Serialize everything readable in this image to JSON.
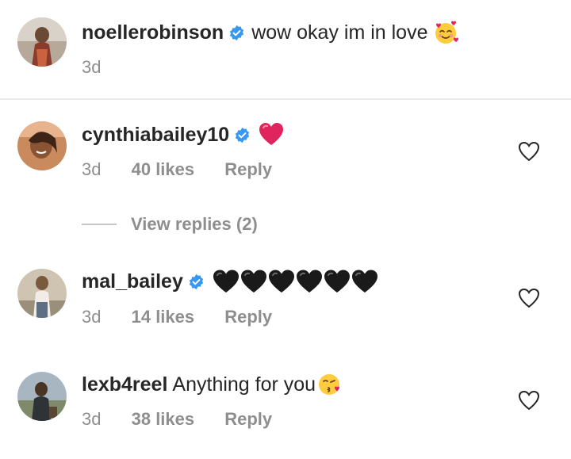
{
  "caption": {
    "username": "noellerobinson",
    "text": "wow okay im in love",
    "emoji": "smiling-face-with-hearts",
    "time": "3d"
  },
  "comments": [
    {
      "username": "cynthiabailey10",
      "verified": true,
      "text": "",
      "emoji": "red-heart",
      "time": "3d",
      "likes": "40 likes",
      "reply": "Reply"
    },
    {
      "username": "mal_bailey",
      "verified": true,
      "text": "",
      "emoji": "black-heart x6",
      "time": "3d",
      "likes": "14 likes",
      "reply": "Reply"
    },
    {
      "username": "lexb4reel",
      "verified": false,
      "text": "Anything for you",
      "emoji": "face-blowing-a-kiss",
      "time": "3d",
      "likes": "38 likes",
      "reply": "Reply"
    }
  ],
  "view_replies": "View replies (2)",
  "colors": {
    "verified_blue": "#3897f0",
    "muted_text": "#8e8e8e",
    "primary_text": "#262626",
    "red_heart": "#e0245e"
  }
}
